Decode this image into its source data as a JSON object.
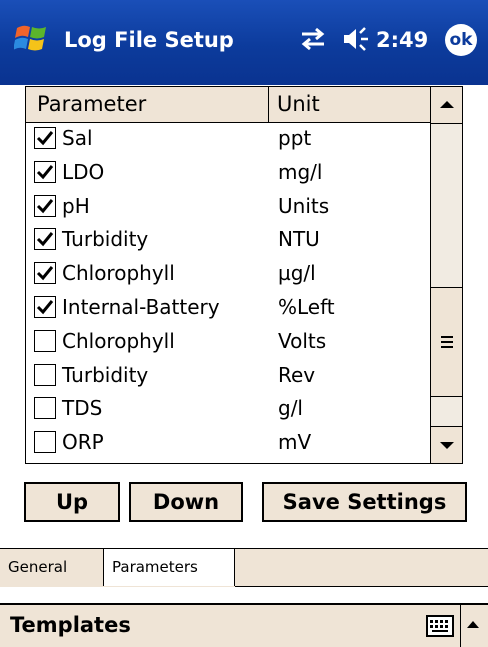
{
  "titlebar": {
    "title": "Log File Setup",
    "time": "2:49",
    "ok_label": "ok",
    "icons": [
      "windows-start-icon",
      "connectivity-icon",
      "volume-icon"
    ]
  },
  "table": {
    "columns": [
      "Parameter",
      "Unit"
    ],
    "rows": [
      {
        "checked": true,
        "param": "Sal",
        "unit": "ppt"
      },
      {
        "checked": true,
        "param": "LDO",
        "unit": "mg/l"
      },
      {
        "checked": true,
        "param": "pH",
        "unit": "Units"
      },
      {
        "checked": true,
        "param": "Turbidity",
        "unit": "NTU"
      },
      {
        "checked": true,
        "param": "Chlorophyll",
        "unit": "µg/l"
      },
      {
        "checked": true,
        "param": "Internal-Battery",
        "unit": "%Left"
      },
      {
        "checked": false,
        "param": "Chlorophyll",
        "unit": "Volts"
      },
      {
        "checked": false,
        "param": "Turbidity",
        "unit": "Rev"
      },
      {
        "checked": false,
        "param": "TDS",
        "unit": "g/l"
      },
      {
        "checked": false,
        "param": "ORP",
        "unit": "mV"
      }
    ]
  },
  "buttons": {
    "up": "Up",
    "down": "Down",
    "save": "Save Settings"
  },
  "tabs": [
    {
      "label": "General",
      "active": false
    },
    {
      "label": "Parameters",
      "active": true
    }
  ],
  "commandbar": {
    "templates": "Templates",
    "keyboard_icon": "keyboard-icon"
  },
  "colors": {
    "titlebar": "#0c3b9c",
    "control_face": "#efe4d6"
  }
}
